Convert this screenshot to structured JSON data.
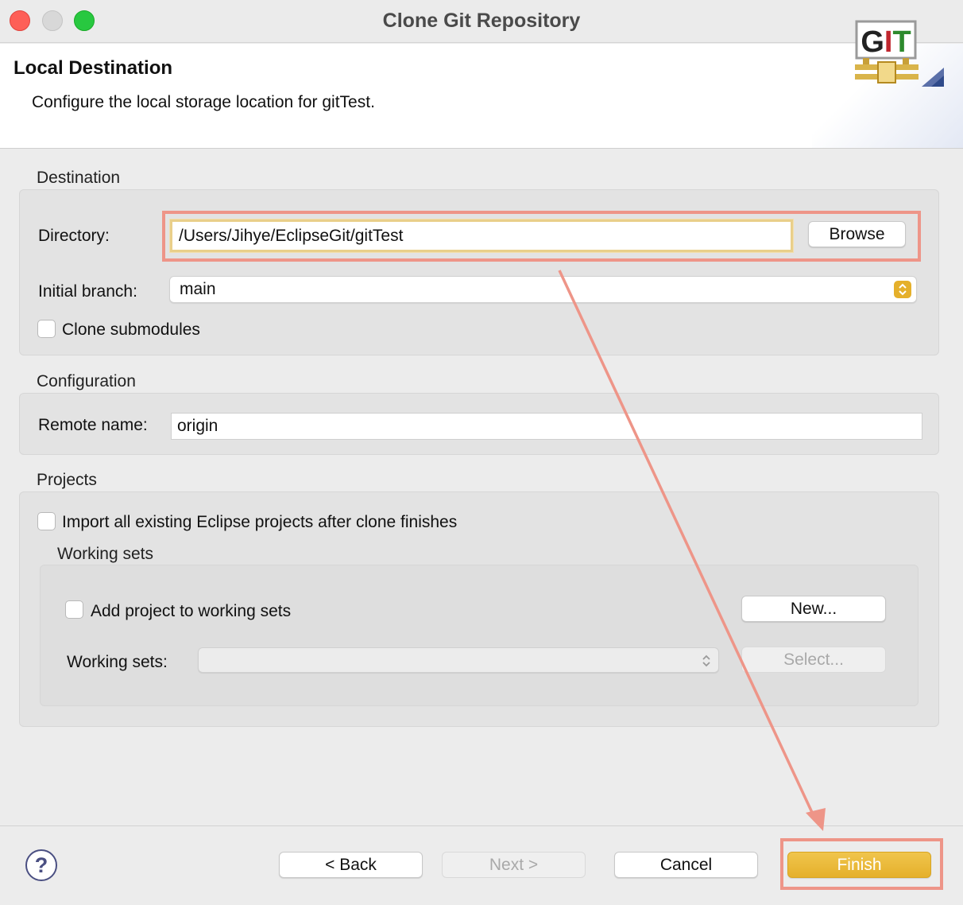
{
  "window": {
    "title": "Clone Git Repository"
  },
  "header": {
    "title": "Local Destination",
    "description": "Configure the local storage location for gitTest.",
    "logo_text": "GIT"
  },
  "destination": {
    "group_label": "Destination",
    "directory_label": "Directory:",
    "directory_value": "/Users/Jihye/EclipseGit/gitTest",
    "browse_label": "Browse",
    "initial_branch_label": "Initial branch:",
    "initial_branch_value": "main",
    "clone_submodules_label": "Clone submodules",
    "clone_submodules_checked": false
  },
  "configuration": {
    "group_label": "Configuration",
    "remote_name_label": "Remote name:",
    "remote_name_value": "origin"
  },
  "projects": {
    "group_label": "Projects",
    "import_label": "Import all existing Eclipse projects after clone finishes",
    "import_checked": false,
    "working_sets_group_label": "Working sets",
    "add_to_working_sets_label": "Add project to working sets",
    "add_to_working_sets_checked": false,
    "new_label": "New...",
    "working_sets_label": "Working sets:",
    "working_sets_value": "",
    "select_label": "Select..."
  },
  "footer": {
    "back_label": "< Back",
    "next_label": "Next >",
    "cancel_label": "Cancel",
    "finish_label": "Finish",
    "help_symbol": "?"
  },
  "colors": {
    "accent": "#e5b02b",
    "highlight": "#ee9588",
    "focus_ring": "#e9cf8a"
  }
}
